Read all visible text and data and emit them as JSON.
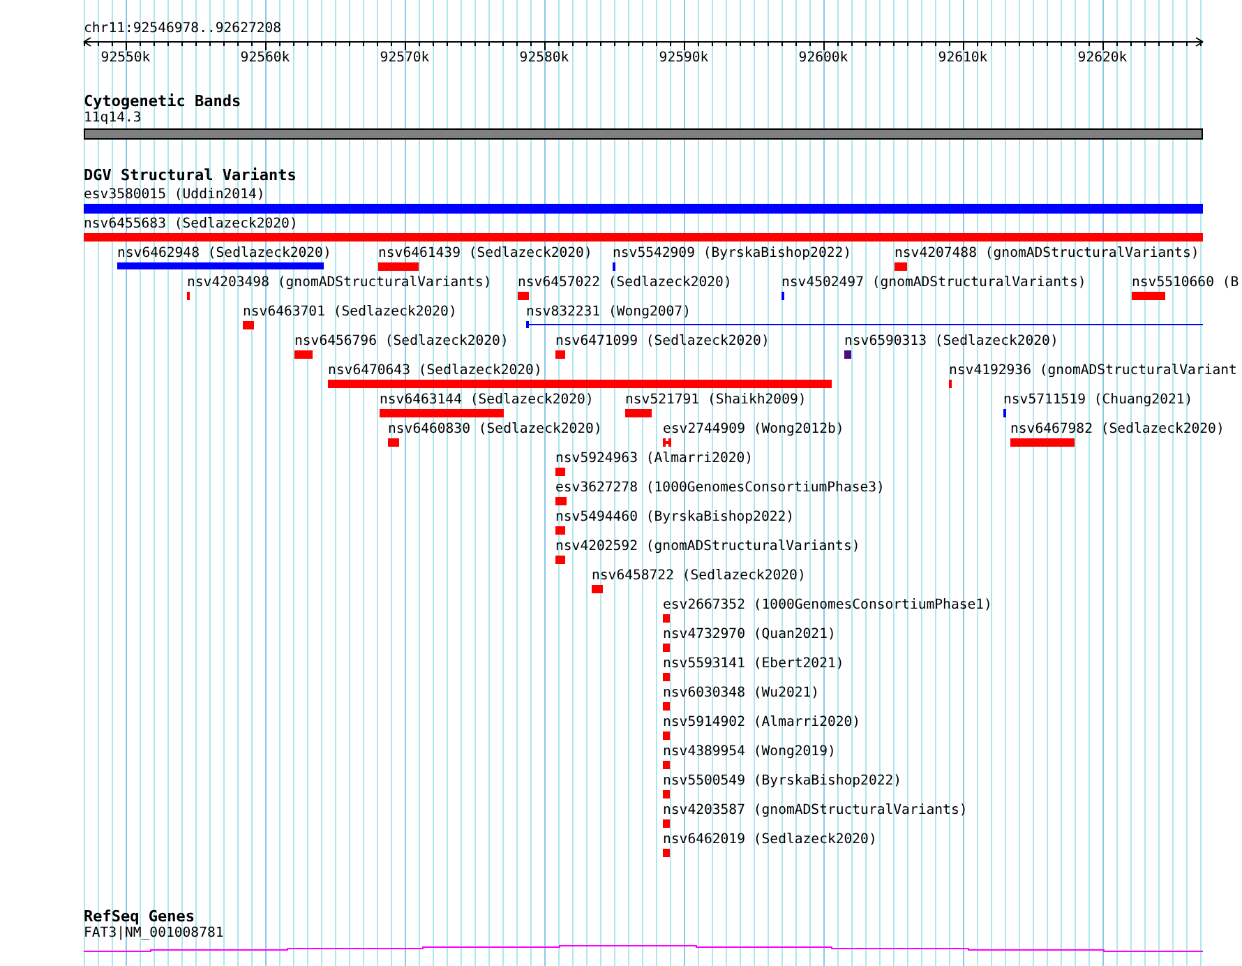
{
  "location": "chr11:92546978..92627208",
  "ruler_ticks": [
    "92550k",
    "92560k",
    "92570k",
    "92580k",
    "92590k",
    "92600k",
    "92610k",
    "92620k"
  ],
  "cytogenetic_bands": {
    "title": "Cytogenetic Bands",
    "band": "11q14.3"
  },
  "dgv": {
    "title": "DGV Structural Variants",
    "variants": [
      {
        "label": "esv3580015 (Uddin2014)",
        "color": "#0000ff",
        "kind": "bar"
      },
      {
        "label": "nsv6455683 (Sedlazeck2020)",
        "color": "#ff0000",
        "kind": "bar"
      },
      {
        "label": "nsv6462948 (Sedlazeck2020)",
        "color": "#0000ff",
        "kind": "bar"
      },
      {
        "label": "nsv6461439 (Sedlazeck2020)",
        "color": "#ff0000",
        "kind": "bar"
      },
      {
        "label": "nsv5542909 (ByrskaBishop2022)",
        "color": "#0000ff",
        "kind": "bar"
      },
      {
        "label": "nsv4207488 (gnomADStructuralVariants)",
        "color": "#ff0000",
        "kind": "bar"
      },
      {
        "label": "nsv4203498 (gnomADStructuralVariants)",
        "color": "#ff0000",
        "kind": "bar"
      },
      {
        "label": "nsv6457022 (Sedlazeck2020)",
        "color": "#ff0000",
        "kind": "bar"
      },
      {
        "label": "nsv4502497 (gnomADStructuralVariants)",
        "color": "#0000ff",
        "kind": "bar"
      },
      {
        "label": "nsv5510660 (B",
        "color": "#ff0000",
        "kind": "bar"
      },
      {
        "label": "nsv6463701 (Sedlazeck2020)",
        "color": "#ff0000",
        "kind": "bar"
      },
      {
        "label": "nsv832231 (Wong2007)",
        "color": "#0000ff",
        "kind": "line"
      },
      {
        "label": "nsv6456796 (Sedlazeck2020)",
        "color": "#ff0000",
        "kind": "bar"
      },
      {
        "label": "nsv6471099 (Sedlazeck2020)",
        "color": "#ff0000",
        "kind": "bar"
      },
      {
        "label": "nsv6590313 (Sedlazeck2020)",
        "color": "#4b0a80",
        "kind": "bar"
      },
      {
        "label": "nsv6470643 (Sedlazeck2020)",
        "color": "#ff0000",
        "kind": "bar"
      },
      {
        "label": "nsv4192936 (gnomADStructuralVariant",
        "color": "#ff0000",
        "kind": "bar"
      },
      {
        "label": "nsv6463144 (Sedlazeck2020)",
        "color": "#ff0000",
        "kind": "bar"
      },
      {
        "label": "nsv521791 (Shaikh2009)",
        "color": "#ff0000",
        "kind": "bar"
      },
      {
        "label": "nsv5711519 (Chuang2021)",
        "color": "#0000ff",
        "kind": "bar"
      },
      {
        "label": "nsv6460830 (Sedlazeck2020)",
        "color": "#ff0000",
        "kind": "bar"
      },
      {
        "label": "esv2744909 (Wong2012b)",
        "color": "#ff0000",
        "kind": "pair"
      },
      {
        "label": "nsv6467982 (Sedlazeck2020)",
        "color": "#ff0000",
        "kind": "bar"
      },
      {
        "label": "nsv5924963 (Almarri2020)",
        "color": "#ff0000",
        "kind": "bar"
      },
      {
        "label": "esv3627278 (1000GenomesConsortiumPhase3)",
        "color": "#ff0000",
        "kind": "bar"
      },
      {
        "label": "nsv5494460 (ByrskaBishop2022)",
        "color": "#ff0000",
        "kind": "bar"
      },
      {
        "label": "nsv4202592 (gnomADStructuralVariants)",
        "color": "#ff0000",
        "kind": "bar"
      },
      {
        "label": "nsv6458722 (Sedlazeck2020)",
        "color": "#ff0000",
        "kind": "bar"
      },
      {
        "label": "esv2667352 (1000GenomesConsortiumPhase1)",
        "color": "#ff0000",
        "kind": "bar"
      },
      {
        "label": "nsv4732970 (Quan2021)",
        "color": "#ff0000",
        "kind": "bar"
      },
      {
        "label": "nsv5593141 (Ebert2021)",
        "color": "#ff0000",
        "kind": "bar"
      },
      {
        "label": "nsv6030348 (Wu2021)",
        "color": "#ff0000",
        "kind": "bar"
      },
      {
        "label": "nsv5914902 (Almarri2020)",
        "color": "#ff0000",
        "kind": "bar"
      },
      {
        "label": "nsv4389954 (Wong2019)",
        "color": "#ff0000",
        "kind": "bar"
      },
      {
        "label": "nsv5500549 (ByrskaBishop2022)",
        "color": "#ff0000",
        "kind": "bar"
      },
      {
        "label": "nsv4203587 (gnomADStructuralVariants)",
        "color": "#ff0000",
        "kind": "bar"
      },
      {
        "label": "nsv6462019 (Sedlazeck2020)",
        "color": "#ff0000",
        "kind": "bar"
      }
    ]
  },
  "refseq": {
    "title": "RefSeq Genes",
    "gene": "FAT3|NM_001008781"
  }
}
